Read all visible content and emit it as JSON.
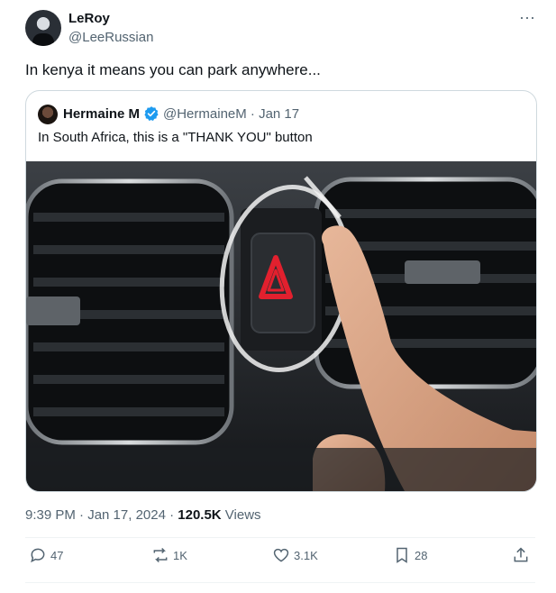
{
  "author": {
    "name": "LeRoy",
    "handle": "@LeeRussian"
  },
  "more_label": "···",
  "text": "In kenya it means you can park anywhere...",
  "quote": {
    "name": "Hermaine M",
    "handle_date": "@HermaineM · Jan 17",
    "text": "In South Africa, this is a \"THANK YOU\" button",
    "image": "car hazard button with finger"
  },
  "meta": {
    "time_date": "9:39 PM · Jan 17, 2024 · ",
    "views_count": "120.5K",
    "views_label": " Views"
  },
  "actions": {
    "replies": "47",
    "reposts": "1K",
    "likes": "3.1K",
    "bookmarks": "28"
  },
  "icons": [
    "reply-icon",
    "repost-icon",
    "like-icon",
    "bookmark-icon",
    "share-icon",
    "verified-icon",
    "more-icon"
  ],
  "colors": {
    "verified": "#1d9bf0",
    "hazard_red": "#e2202e",
    "secondary_text": "#536471"
  }
}
